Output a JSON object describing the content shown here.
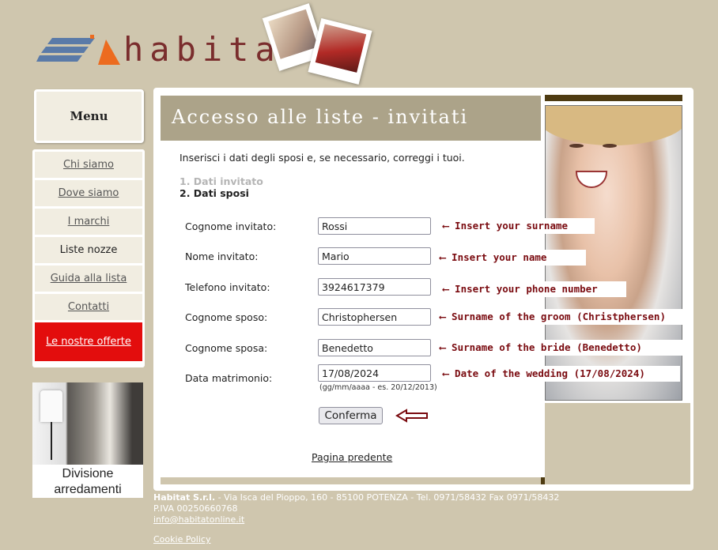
{
  "brand": {
    "name": "habitat"
  },
  "menu": {
    "title": "Menu",
    "items": [
      {
        "label": "Chi siamo"
      },
      {
        "label": "Dove siamo"
      },
      {
        "label": "I marchi"
      },
      {
        "label": "Liste nozze"
      },
      {
        "label": "Guida alla lista"
      },
      {
        "label": "Contatti"
      },
      {
        "label": "Le nostre offerte"
      }
    ],
    "division_caption": "Divisione arredamenti"
  },
  "main": {
    "title": "Accesso alle liste - invitati",
    "intro": "Inserisci i dati degli sposi e, se necessario, correggi i tuoi.",
    "steps": [
      "1. Dati invitato",
      "2. Dati sposi"
    ],
    "fields": [
      {
        "label": "Cognome invitato:",
        "value": "Rossi"
      },
      {
        "label": "Nome invitato:",
        "value": "Mario"
      },
      {
        "label": "Telefono invitato:",
        "value": "3924617379"
      },
      {
        "label": "Cognome sposo:",
        "value": "Christophersen"
      },
      {
        "label": "Cognome sposa:",
        "value": "Benedetto"
      },
      {
        "label": "Data matrimonio:",
        "value": "17/08/2024"
      }
    ],
    "date_hint": "(gg/mm/aaaa - es. 20/12/2013)",
    "confirm_label": "Conferma",
    "back_label": "Pagina predente"
  },
  "annotations": [
    "⟵ Insert your surname",
    "⟵ Insert your name",
    "⟵ Insert your phone number",
    "⟵ Surname of the groom (Christphersen)",
    "⟵ Surname of the bride (Benedetto)",
    "⟵ Date of the wedding (17/08/2024)"
  ],
  "footer": {
    "company": "Habitat S.r.l.",
    "address": " - Via Isca del Pioppo, 160 - 85100 POTENZA - Tel. 0971/58432 Fax 0971/58432",
    "vat": "P.IVA 00250660768",
    "email": "info@habitatonline.it",
    "cookie": "Cookie Policy"
  },
  "colors": {
    "background": "#cfc6ae",
    "title_bar": "#aca389",
    "dark_bar": "#4e3b12",
    "offer": "#e30d0d",
    "annotation": "#7a0b10"
  }
}
